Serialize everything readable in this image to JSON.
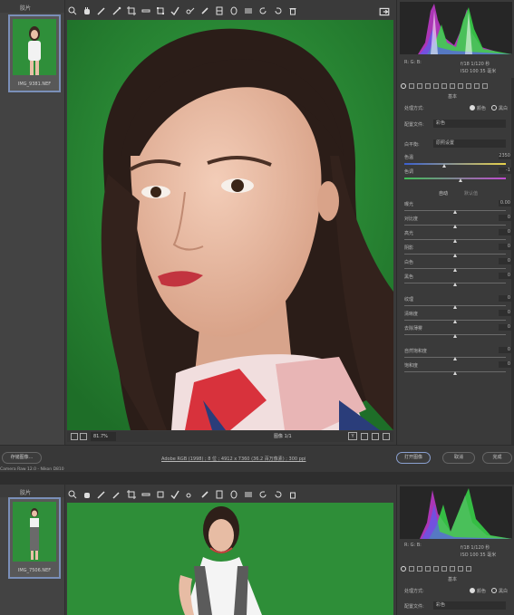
{
  "window1": {
    "filmstrip_title": "胶片",
    "thumb_caption": "IMG_9381.NEF",
    "histogram_readout": {
      "rgb_label": "R: G: B:",
      "exposure": "f/18  1/120 秒",
      "iso": "ISO 100  35 毫米"
    },
    "panel_title": "基本",
    "treatment_label": "处理方式:",
    "treatment_color": "颜色",
    "treatment_bw": "黑白",
    "profile_label": "配置文件:",
    "profile_value": "彩色",
    "wb_label": "白平衡:",
    "wb_value": "原照设置",
    "temp_label": "色温",
    "temp_value": "2350",
    "tint_label": "色调",
    "tint_value": "-1",
    "auto_label": "自动",
    "default_label": "默认值",
    "sliders": [
      {
        "label": "曝光",
        "value": "0.00"
      },
      {
        "label": "对比度",
        "value": "0"
      },
      {
        "label": "高光",
        "value": "0"
      },
      {
        "label": "阴影",
        "value": "0"
      },
      {
        "label": "白色",
        "value": "0"
      },
      {
        "label": "黑色",
        "value": "0"
      },
      {
        "label": "纹理",
        "value": "0"
      },
      {
        "label": "清晰度",
        "value": "0"
      },
      {
        "label": "去除薄雾",
        "value": "0"
      },
      {
        "label": "自然饱和度",
        "value": "0"
      },
      {
        "label": "饱和度",
        "value": "0"
      }
    ],
    "zoom_value": "81.7%",
    "filmstrip_count": "图像 1/1",
    "status": {
      "open_button": "存储图像...",
      "info": "Adobe RGB (1998) ; 8 位 ; 4912 x 7360 (36.2 百万像素) ; 300 ppi",
      "open_image_button": "打开图像",
      "cancel_button": "取消",
      "done_button": "完成"
    },
    "title_strip": "Camera Raw 12.0 - Nikon D810"
  },
  "window2": {
    "filmstrip_title": "胶片",
    "thumb_caption": "IMG_7506.NEF",
    "histogram_readout": {
      "rgb_label": "R: G: B:",
      "exposure": "f/18  1/120 秒",
      "iso": "ISO 100  35 毫米"
    },
    "panel_title": "基本",
    "treatment_label": "处理方式:",
    "treatment_color": "颜色",
    "treatment_bw": "黑白",
    "profile_label": "配置文件:",
    "profile_value": "彩色"
  },
  "colors": {
    "green_screen": "#2d8a36",
    "panel_bg": "#3a3a3a",
    "accent_blue": "#7a8fb8"
  },
  "toolbar_icons": [
    "zoom-icon",
    "hand-icon",
    "white-balance-icon",
    "color-sampler-icon",
    "crop-icon",
    "straighten-icon",
    "transform-icon",
    "spot-removal-icon",
    "red-eye-icon",
    "adjustment-brush-icon",
    "graduated-filter-icon",
    "radial-filter-icon",
    "preferences-icon",
    "rotate-left-icon",
    "rotate-right-icon",
    "trash-icon"
  ]
}
